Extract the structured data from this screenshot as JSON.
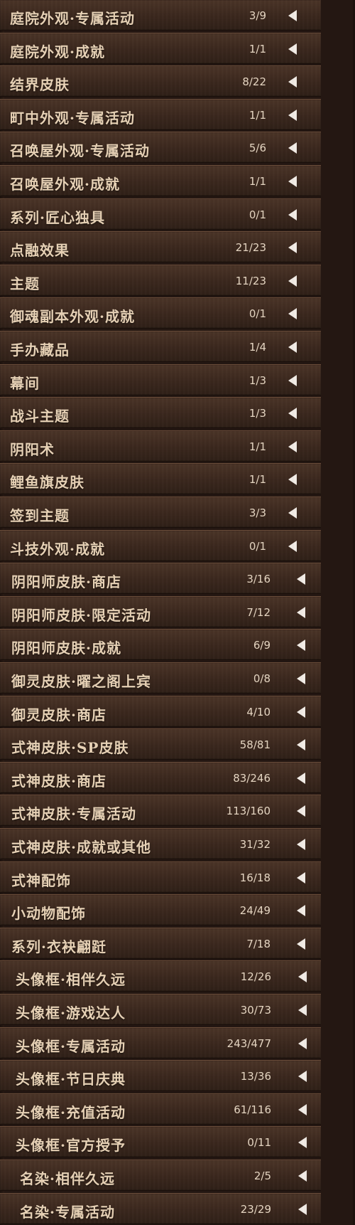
{
  "items": [
    {
      "label": "庭院外观·专属活动",
      "count": "3/9"
    },
    {
      "label": "庭院外观·成就",
      "count": "1/1"
    },
    {
      "label": "结界皮肤",
      "count": "8/22"
    },
    {
      "label": "町中外观·专属活动",
      "count": "1/1"
    },
    {
      "label": "召唤屋外观·专属活动",
      "count": "5/6"
    },
    {
      "label": "召唤屋外观·成就",
      "count": "1/1"
    },
    {
      "label": "系列·匠心独具",
      "count": "0/1"
    },
    {
      "label": "点融效果",
      "count": "21/23"
    },
    {
      "label": "主题",
      "count": "11/23"
    },
    {
      "label": "御魂副本外观·成就",
      "count": "0/1"
    },
    {
      "label": "手办藏品",
      "count": "1/4"
    },
    {
      "label": "幕间",
      "count": "1/3"
    },
    {
      "label": "战斗主题",
      "count": "1/3"
    },
    {
      "label": "阴阳术",
      "count": "1/1"
    },
    {
      "label": "鲤鱼旗皮肤",
      "count": "1/1"
    },
    {
      "label": "签到主题",
      "count": "3/3"
    },
    {
      "label": "斗技外观·成就",
      "count": "0/1"
    },
    {
      "label": "阴阳师皮肤·商店",
      "count": "3/16"
    },
    {
      "label": "阴阳师皮肤·限定活动",
      "count": "7/12"
    },
    {
      "label": "阴阳师皮肤·成就",
      "count": "6/9"
    },
    {
      "label": "御灵皮肤·曜之阁上宾",
      "count": "0/8"
    },
    {
      "label": "御灵皮肤·商店",
      "count": "4/10"
    },
    {
      "label": "式神皮肤·SP皮肤",
      "count": "58/81"
    },
    {
      "label": "式神皮肤·商店",
      "count": "83/246"
    },
    {
      "label": "式神皮肤·专属活动",
      "count": "113/160"
    },
    {
      "label": "式神皮肤·成就或其他",
      "count": "31/32"
    },
    {
      "label": "式神配饰",
      "count": "16/18"
    },
    {
      "label": "小动物配饰",
      "count": "24/49"
    },
    {
      "label": "系列·衣袂翩跹",
      "count": "7/18"
    },
    {
      "label": "头像框·相伴久远",
      "count": "12/26"
    },
    {
      "label": "头像框·游戏达人",
      "count": "30/73"
    },
    {
      "label": "头像框·专属活动",
      "count": "243/477"
    },
    {
      "label": "头像框·节日庆典",
      "count": "13/36"
    },
    {
      "label": "头像框·充值活动",
      "count": "61/116"
    },
    {
      "label": "头像框·官方授予",
      "count": "0/11"
    },
    {
      "label": "名染·相伴久远",
      "count": "2/5"
    },
    {
      "label": "名染·专属活动",
      "count": "23/29"
    }
  ]
}
